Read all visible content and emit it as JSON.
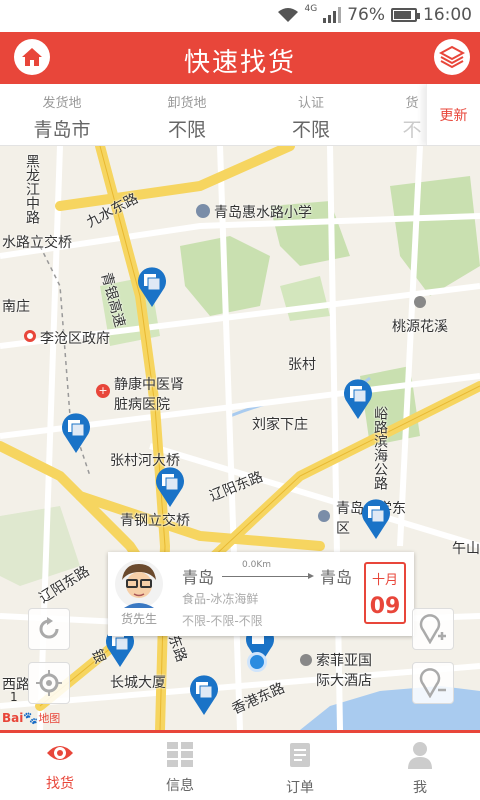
{
  "status_bar": {
    "network": "4G",
    "battery": "76%",
    "battery_level": 0.76,
    "time": "16:00"
  },
  "header": {
    "title": "快速找货"
  },
  "filters": [
    {
      "label": "发货地",
      "value": "青岛市"
    },
    {
      "label": "卸货地",
      "value": "不限"
    },
    {
      "label": "认证",
      "value": "不限"
    },
    {
      "label": "货",
      "value": "不"
    }
  ],
  "refresh_label": "更新",
  "map": {
    "labels": {
      "l1": "黑龙江中路",
      "l2": "九水东路",
      "l3": "青岛惠水路小学",
      "l4": "水路立交桥",
      "l5": "青银高速",
      "l6": "南庄",
      "l7": "李沧区政府",
      "l8": "桃源花溪",
      "l9": "静康中医肾脏病医院",
      "l10": "张村",
      "l11": "刘家下庄",
      "l12": "峪路滨海公路",
      "l13": "张村河大桥",
      "l14": "辽阳东路",
      "l15": "青钢立交桥",
      "l16": "青岛大学东区",
      "l17": "午山",
      "l18": "辽阳东路",
      "l19": "银",
      "l20": "长城大厦",
      "l21": "香港东路",
      "l22": "索菲亚国际大酒店",
      "l23": "西路",
      "l24": "东路"
    },
    "scale": "1",
    "logo_text": "Bai",
    "logo_text2": "地图"
  },
  "card": {
    "avatar_name": "货先生",
    "from": "青岛",
    "to": "青岛",
    "distance": "0.0Km",
    "cargo": "食品-冰冻海鲜",
    "specs": "不限-不限-不限",
    "month": "十月",
    "day": "09"
  },
  "tabs": [
    {
      "label": "找货",
      "icon": "eye-icon",
      "active": true
    },
    {
      "label": "信息",
      "icon": "grid-icon",
      "active": false
    },
    {
      "label": "订单",
      "icon": "document-icon",
      "active": false
    },
    {
      "label": "我",
      "icon": "person-icon",
      "active": false
    }
  ],
  "colors": {
    "accent": "#e8463a",
    "pin": "#1a73c7"
  }
}
